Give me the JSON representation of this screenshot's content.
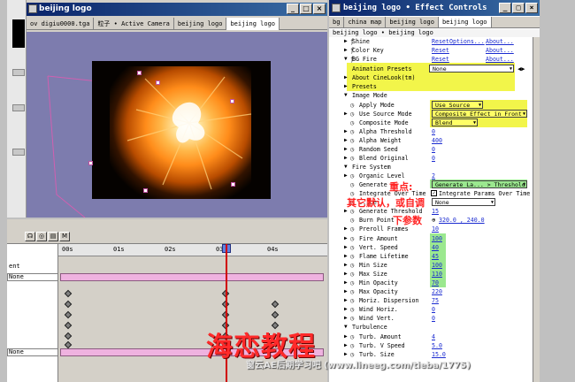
{
  "comp_window": {
    "title": "beijing logo",
    "tabs": [
      "ov digiu0000.tga",
      "粒子 • Active Camera",
      "beijing logo",
      "beijing logo"
    ],
    "active_tab": 3
  },
  "timeline": {
    "ruler_ticks": [
      "00s",
      "01s",
      "02s",
      "03s",
      "04s"
    ],
    "left_labels": {
      "header": "ent",
      "row1": "None",
      "row2": "None"
    }
  },
  "effect_controls": {
    "title": "beijing logo • Effect Controls",
    "tabs": [
      "bg",
      "china map",
      "beijing logo",
      "beijing logo"
    ],
    "subheader": "beijing logo • beijing logo",
    "shine": {
      "name": "Shine",
      "reset": "Reset",
      "options": "Options...",
      "about": "About..."
    },
    "colorkey": {
      "name": "Color Key",
      "reset": "Reset",
      "about": "About..."
    },
    "bgfire": {
      "name": "BG Fire",
      "reset": "Reset",
      "about": "About..."
    },
    "animation_presets": {
      "label": "Animation Presets",
      "value": "None"
    },
    "about_cinelook": "About CineLook(tm)",
    "presets": "Presets",
    "image_mode": "Image Mode",
    "apply_mode": {
      "label": "Apply Mode",
      "value": "Use Source"
    },
    "use_source_mode": {
      "label": "Use Source Mode",
      "value": "Composite Effect in Front"
    },
    "composite_mode": {
      "label": "Composite Mode",
      "value": "Blend"
    },
    "alpha_threshold": {
      "label": "Alpha Threshold",
      "value": "0"
    },
    "alpha_weight": {
      "label": "Alpha Weight",
      "value": "400"
    },
    "random_seed": {
      "label": "Random Seed",
      "value": "0"
    },
    "blend_original": {
      "label": "Blend Original",
      "value": "0"
    },
    "fire_system": "Fire System",
    "organic_level": {
      "label": "Organic Level",
      "value": "2"
    },
    "generate": {
      "label": "Generate",
      "value": "Generate La... > Threshold"
    },
    "integrate_over_time": {
      "label": "Integrate Over Time",
      "value": "Integrate Params Over Time"
    },
    "integrate_row3": {
      "label": "...ce",
      "value": "None"
    },
    "generate_threshold": {
      "label": "Generate Threshold",
      "value": "15"
    },
    "burn_point": {
      "label": "Burn Point",
      "value": "320.0 , 240.0"
    },
    "preroll_frames": {
      "label": "Preroll Frames",
      "value": "10"
    },
    "fire_amount": {
      "label": "Fire Amount",
      "value": "100"
    },
    "vert_speed": {
      "label": "Vert. Speed",
      "value": "40"
    },
    "flame_lifetime": {
      "label": "Flame Lifetime",
      "value": "45"
    },
    "min_size": {
      "label": "Min Size",
      "value": "100"
    },
    "max_size": {
      "label": "Max Size",
      "value": "110"
    },
    "min_opacity": {
      "label": "Min Opacity",
      "value": "70"
    },
    "max_opacity": {
      "label": "Max Opacity",
      "value": "220"
    },
    "moriz_dispersion": {
      "label": "Moriz. Dispersion",
      "value": "75"
    },
    "wind_horiz": {
      "label": "Wind Horiz.",
      "value": "0"
    },
    "wind_vert": {
      "label": "Wind Vert.",
      "value": "0"
    },
    "turbulence": "Turbulence",
    "turb_amount": {
      "label": "Turb. Amount",
      "value": "4"
    },
    "turb_vspeed": {
      "label": "Turb. V Speed",
      "value": "5.0"
    },
    "turb_size": {
      "label": "Turb. Size",
      "value": "15.0"
    }
  },
  "annotation": {
    "line1": "重点:",
    "line2": "其它默认，或自调",
    "line3": "下参数"
  },
  "watermark": {
    "title": "海恋教程",
    "subtitle": "窗云AE后期学习吧  (www.lineeg.com/tieba/1775)"
  }
}
